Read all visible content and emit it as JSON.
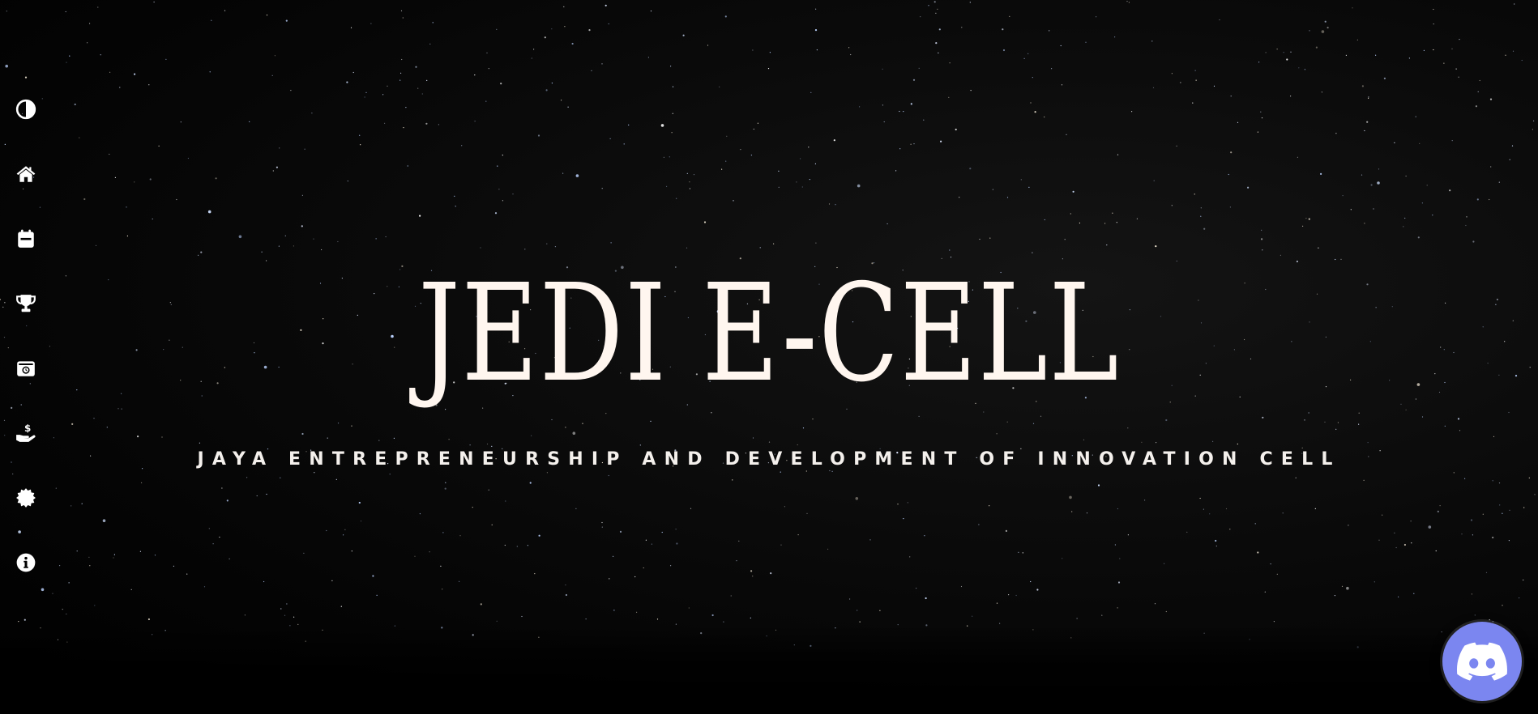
{
  "hero": {
    "title": "JEDI E-CELL",
    "subtitle": "JAYA ENTREPRENEURSHIP AND DEVELOPMENT OF INNOVATION CELL"
  },
  "sidebar": {
    "items": [
      {
        "icon": "contrast-icon"
      },
      {
        "icon": "home-icon"
      },
      {
        "icon": "calendar-icon"
      },
      {
        "icon": "trophy-icon"
      },
      {
        "icon": "gallery-icon"
      },
      {
        "icon": "sponsor-hand-dollar-icon"
      },
      {
        "icon": "badge-icon"
      },
      {
        "icon": "info-icon"
      }
    ]
  },
  "discord": {
    "icon": "discord-icon"
  },
  "colors": {
    "background": "#000000",
    "title": "#fff6ef",
    "icons": "#ffffff",
    "discord": "#7b86f0"
  }
}
